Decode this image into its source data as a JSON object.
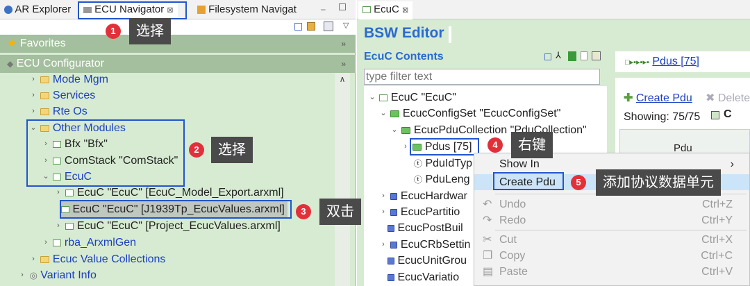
{
  "left": {
    "tabs": [
      {
        "label": "AR Explorer"
      },
      {
        "label": "ECU Navigator",
        "close": "⊠"
      },
      {
        "label": "Filesystem Navigat"
      }
    ],
    "favorites": "Favorites",
    "ecu_configurator": "ECU Configurator",
    "tree": {
      "mode_mgm": "Mode Mgm",
      "services": "Services",
      "rte_os": "Rte Os",
      "other_modules": "Other Modules",
      "bfx": "Bfx \"Bfx\"",
      "comstack": "ComStack \"ComStack\"",
      "ecuc": "EcuC",
      "ecuc_model_export": "EcuC \"EcuC\" [EcuC_Model_Export.arxml]",
      "ecuc_j1939": "EcuC \"EcuC\" [J1939Tp_EcucValues.arxml]",
      "ecuc_project": "EcuC \"EcuC\" [Project_EcucValues.arxml]",
      "rba_arxmlgen": "rba_ArxmlGen",
      "ecuc_value_collections": "Ecuc Value Collections",
      "variant_info": "Variant Info"
    }
  },
  "right": {
    "tab": {
      "label": "EcuC",
      "close": "⊠"
    },
    "editor_title": "BSW Editor",
    "contents_title": "EcuC Contents",
    "filter_placeholder": "type filter text",
    "breadcrumb_link": "Pdus [75]",
    "create_pdu": "Create Pdu",
    "delete": "Delete",
    "showing": "Showing: 75/75",
    "column_pdu": "Pdu",
    "tree": {
      "ecuc_root": "EcuC \"EcuC\"",
      "config_set": "EcucConfigSet \"EcucConfigSet\"",
      "pdu_collection": "EcucPduCollection \"PduCollection\"",
      "pdus": "Pdus [75]",
      "pdu_id_typ": "PduIdTyp",
      "pdu_leng": "PduLeng",
      "hardwar": "EcucHardwar",
      "partitio": "EcucPartitio",
      "postbuil": "EcucPostBuil",
      "crbsettin": "EcuCRbSettin",
      "unitgrou": "EcucUnitGrou",
      "variatio": "EcucVariatio"
    }
  },
  "context_menu": {
    "show_in": "Show In",
    "create_pdu": "Create Pdu",
    "undo": "Undo",
    "undo_key": "Ctrl+Z",
    "redo": "Redo",
    "redo_key": "Ctrl+Y",
    "cut": "Cut",
    "cut_key": "Ctrl+X",
    "copy": "Copy",
    "copy_key": "Ctrl+C",
    "paste": "Paste",
    "paste_key": "Ctrl+V"
  },
  "annotations": [
    {
      "num": "1",
      "text": "选择"
    },
    {
      "num": "2",
      "text": "选择"
    },
    {
      "num": "3",
      "text": "双击"
    },
    {
      "num": "4",
      "text": "右键"
    },
    {
      "num": "5",
      "text": "添加协议数据单元"
    }
  ],
  "colors": {
    "tree_bg": "#d7ebd2",
    "section_bg": "#a3bf9d",
    "link_blue": "#1a3fc0",
    "badge_red": "#e2303a",
    "highlight_blue": "#2255cc"
  }
}
